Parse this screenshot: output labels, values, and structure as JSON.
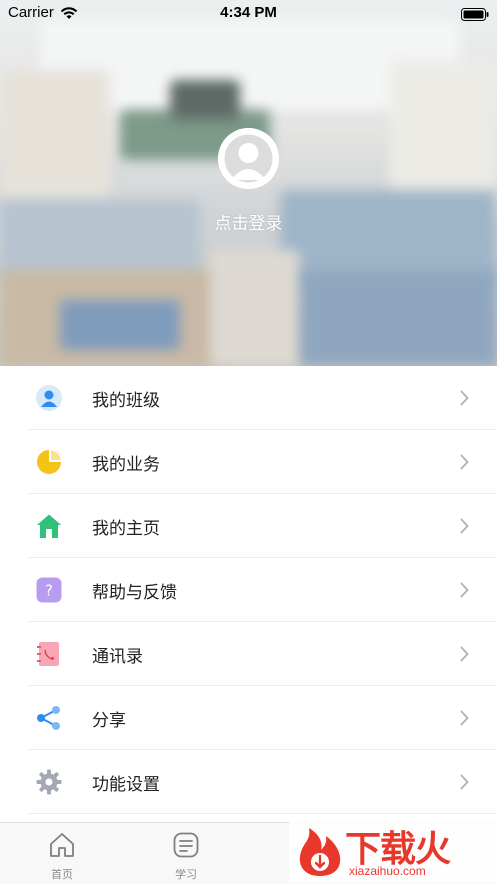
{
  "status_bar": {
    "carrier": "Carrier",
    "time": "4:34 PM"
  },
  "profile": {
    "login_text": "点击登录"
  },
  "menu": [
    {
      "label": "我的班级",
      "icon": "person-icon",
      "color": "#2e8ef0"
    },
    {
      "label": "我的业务",
      "icon": "pie-chart-icon",
      "color": "#f5c218"
    },
    {
      "label": "我的主页",
      "icon": "home-icon",
      "color": "#2fc07a"
    },
    {
      "label": "帮助与反馈",
      "icon": "help-icon",
      "color": "#a98ff0"
    },
    {
      "label": "通讯录",
      "icon": "contacts-book-icon",
      "color": "#f07a8e"
    },
    {
      "label": "分享",
      "icon": "share-icon",
      "color": "#2e8ef0"
    },
    {
      "label": "功能设置",
      "icon": "gear-icon",
      "color": "#9aa0a8"
    }
  ],
  "tabbar": [
    {
      "label": "首页",
      "icon": "home-outline-icon"
    },
    {
      "label": "学习",
      "icon": "study-icon"
    }
  ],
  "watermark": {
    "main": "下载火",
    "sub": "xiazaihuo.com"
  }
}
